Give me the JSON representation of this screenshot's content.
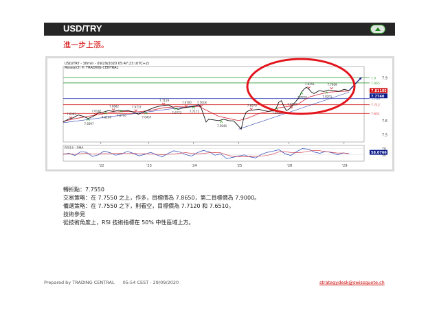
{
  "header": {
    "title": "USD/TRY",
    "button_icon": "chevron-up-icon"
  },
  "subtitle": "進一步上漲。",
  "chart_data": {
    "type": "line",
    "title": "USD/TRY - 30min - 09/29/2020 05:47:23 (UTC+2)",
    "subtitle": "Research © TRADING CENTRAL",
    "x_ticks": [
      "22",
      "23",
      "24",
      "25",
      "28",
      "29"
    ],
    "y_ticks": [
      "7.9",
      "7.6",
      "7.5"
    ],
    "y_ticks_mid": "7.6",
    "ylim": [
      7.45,
      7.98
    ],
    "levels": [
      {
        "value": 7.9,
        "color": "#4aa84a",
        "label": "7.9"
      },
      {
        "value": 7.865,
        "color": "#4aa84a",
        "label": "7.865"
      },
      {
        "value": 7.755,
        "color": "#2a3fb4",
        "label": "7.755"
      },
      {
        "value": 7.712,
        "color": "#d93a3a",
        "label": "7.712"
      },
      {
        "value": 7.651,
        "color": "#d93a3a",
        "label": "7.651"
      }
    ],
    "price_badges": [
      {
        "value": 7.8111,
        "label": "7.81105",
        "color": "#d00000"
      },
      {
        "value": 7.774,
        "label": "7.7740",
        "color": "#0a1a8a"
      }
    ],
    "annotations": [
      "7.6392",
      "7.6097",
      "7.6142",
      "7.6190",
      "7.6682",
      "7.6700",
      "7.6737",
      "7.6457",
      "7.7119",
      "7.6772",
      "7.6700",
      "7.7171",
      "7.5618",
      "7.5644",
      "7.6979",
      "7.6424",
      "7.6515",
      "7.7828",
      "7.8351",
      "7.8201",
      "7.7609"
    ],
    "price": [
      [
        0,
        7.59
      ],
      [
        4,
        7.61
      ],
      [
        8,
        7.62
      ],
      [
        12,
        7.64
      ],
      [
        16,
        7.63
      ],
      [
        20,
        7.615
      ],
      [
        24,
        7.63
      ],
      [
        28,
        7.655
      ],
      [
        32,
        7.66
      ],
      [
        36,
        7.67
      ],
      [
        40,
        7.665
      ],
      [
        44,
        7.672
      ],
      [
        48,
        7.668
      ],
      [
        52,
        7.67
      ],
      [
        56,
        7.66
      ],
      [
        60,
        7.645
      ],
      [
        64,
        7.66
      ],
      [
        68,
        7.675
      ],
      [
        72,
        7.69
      ],
      [
        76,
        7.7
      ],
      [
        80,
        7.706
      ],
      [
        84,
        7.71
      ],
      [
        88,
        7.69
      ],
      [
        92,
        7.68
      ],
      [
        96,
        7.69
      ],
      [
        100,
        7.695
      ],
      [
        104,
        7.7
      ],
      [
        108,
        7.712
      ],
      [
        110,
        7.69
      ],
      [
        112,
        7.64
      ],
      [
        114,
        7.59
      ],
      [
        116,
        7.61
      ],
      [
        120,
        7.605
      ],
      [
        124,
        7.6
      ],
      [
        128,
        7.61
      ],
      [
        132,
        7.6
      ],
      [
        136,
        7.598
      ],
      [
        140,
        7.56
      ],
      [
        142,
        7.54
      ],
      [
        144,
        7.62
      ],
      [
        146,
        7.66
      ],
      [
        148,
        7.67
      ],
      [
        152,
        7.675
      ],
      [
        156,
        7.68
      ],
      [
        160,
        7.67
      ],
      [
        164,
        7.665
      ],
      [
        168,
        7.67
      ],
      [
        170,
        7.69
      ],
      [
        172,
        7.73
      ],
      [
        174,
        7.74
      ],
      [
        176,
        7.7
      ],
      [
        178,
        7.67
      ],
      [
        180,
        7.68
      ],
      [
        184,
        7.72
      ],
      [
        188,
        7.76
      ],
      [
        190,
        7.8
      ],
      [
        192,
        7.82
      ],
      [
        194,
        7.835
      ],
      [
        196,
        7.82
      ],
      [
        198,
        7.8
      ],
      [
        200,
        7.79
      ],
      [
        204,
        7.81
      ],
      [
        208,
        7.805
      ],
      [
        212,
        7.815
      ],
      [
        216,
        7.81
      ],
      [
        220,
        7.805
      ],
      [
        224,
        7.82
      ],
      [
        228,
        7.811
      ]
    ],
    "ma": [
      [
        0,
        7.595
      ],
      [
        10,
        7.615
      ],
      [
        20,
        7.63
      ],
      [
        30,
        7.645
      ],
      [
        40,
        7.66
      ],
      [
        50,
        7.665
      ],
      [
        60,
        7.662
      ],
      [
        70,
        7.672
      ],
      [
        80,
        7.69
      ],
      [
        90,
        7.698
      ],
      [
        100,
        7.695
      ],
      [
        108,
        7.7
      ],
      [
        116,
        7.665
      ],
      [
        124,
        7.63
      ],
      [
        132,
        7.615
      ],
      [
        140,
        7.6
      ],
      [
        148,
        7.62
      ],
      [
        156,
        7.65
      ],
      [
        164,
        7.665
      ],
      [
        172,
        7.69
      ],
      [
        180,
        7.7
      ],
      [
        188,
        7.72
      ],
      [
        196,
        7.765
      ],
      [
        204,
        7.785
      ],
      [
        212,
        7.8
      ],
      [
        220,
        7.805
      ],
      [
        228,
        7.808
      ]
    ],
    "forecast_arrow": [
      [
        228,
        7.811
      ],
      [
        238,
        7.905
      ]
    ],
    "rsi_label": "RSI14 - SMA",
    "rsi_values": [
      52,
      55,
      48,
      60,
      58,
      45,
      50,
      62,
      57,
      49,
      53,
      61,
      55,
      47,
      52,
      58,
      50,
      44,
      55,
      63,
      59,
      51,
      46,
      57,
      64,
      60,
      49,
      53,
      38,
      42,
      46,
      50,
      44,
      40,
      52,
      58,
      62,
      66,
      54,
      48,
      60,
      70,
      68,
      59,
      55,
      61,
      57,
      50,
      56,
      54
    ],
    "rsi_ticks": [
      "70",
      "50"
    ],
    "rsi_badge": "58.0766",
    "rsi_badge_color": "#0a1a8a"
  },
  "notes": {
    "pivot": "轉折點：7.7550",
    "strategy": "交易策略：在 7.7550 之上，作多，目標價為 7.8650，第二目標價為 7.9000。",
    "alternative": "備選策略：在 7.7550 之下，則看空，目標價為 7.7120 和 7.6510。",
    "tech_heading": "技術參見",
    "tech_body": "從技術角度上，RSI 技術指標在 50% 中性區域上方。"
  },
  "footer": {
    "prepared": "Prepared by TRADING CENTRAL",
    "time": "05:54 CEST - 29/09/2020",
    "email": "strategydesk@swissquote.ch"
  }
}
